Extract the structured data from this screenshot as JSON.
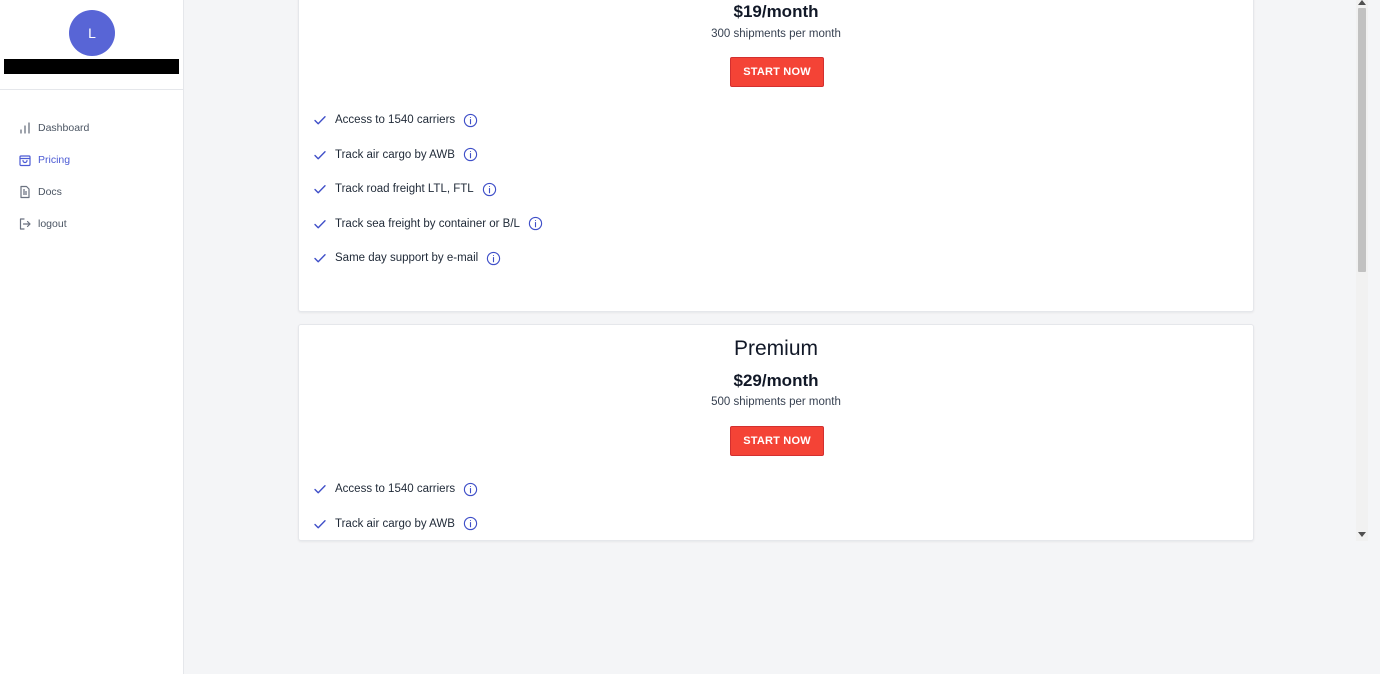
{
  "sidebar": {
    "avatar_initial": "L",
    "items": [
      {
        "label": "Dashboard",
        "icon": "bar-chart-icon",
        "active": false
      },
      {
        "label": "Pricing",
        "icon": "shopping-bag-icon",
        "active": true
      },
      {
        "label": "Docs",
        "icon": "document-icon",
        "active": false
      },
      {
        "label": "logout",
        "icon": "logout-icon",
        "active": false
      }
    ]
  },
  "plans": [
    {
      "name": "",
      "price": "$19/month",
      "shipments": "300 shipments per month",
      "button_label": "START NOW",
      "features": [
        "Access to 1540 carriers",
        "Track air cargo by AWB",
        "Track road freight LTL, FTL",
        "Track sea freight by container or B/L",
        "Same day support by e-mail"
      ]
    },
    {
      "name": "Premium",
      "price": "$29/month",
      "shipments": "500 shipments per month",
      "button_label": "START NOW",
      "features": [
        "Access to 1540 carriers",
        "Track air cargo by AWB"
      ]
    }
  ],
  "colors": {
    "accent": "#4c5bd4",
    "avatar": "#5865d6",
    "cta": "#f44336",
    "background": "#f4f5f7"
  }
}
